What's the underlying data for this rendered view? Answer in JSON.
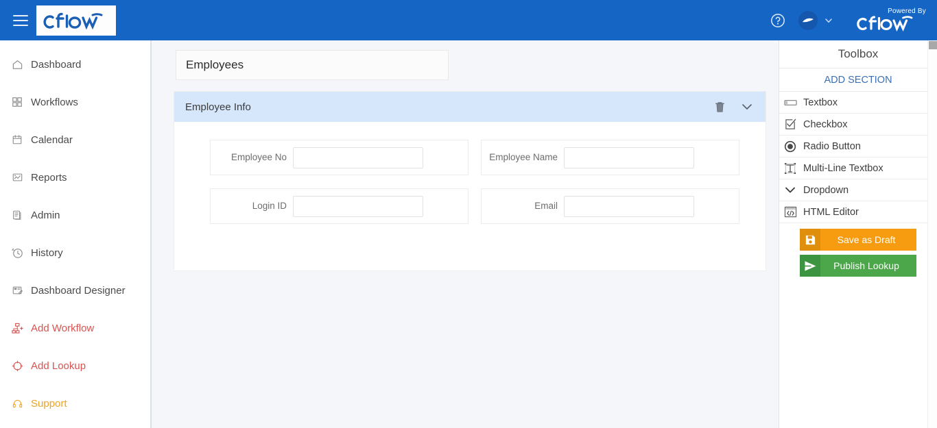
{
  "topbar": {
    "menu_icon": "hamburger-icon",
    "brand": "cflow",
    "help_icon": "help-circle-icon",
    "avatar_icon": "user-avatar-icon",
    "user_chevron_icon": "chevron-down-icon",
    "powered_by_label": "Powered By",
    "powered_brand": "cflow",
    "background_color": "#1565c4"
  },
  "sidebar": {
    "items": [
      {
        "label": "Dashboard",
        "icon": "home-icon",
        "accent": ""
      },
      {
        "label": "Workflows",
        "icon": "grid-icon",
        "accent": ""
      },
      {
        "label": "Calendar",
        "icon": "calendar-icon",
        "accent": ""
      },
      {
        "label": "Reports",
        "icon": "report-icon",
        "accent": ""
      },
      {
        "label": "Admin",
        "icon": "book-icon",
        "accent": ""
      },
      {
        "label": "History",
        "icon": "clock-icon",
        "accent": ""
      },
      {
        "label": "Dashboard Designer",
        "icon": "dashboard-designer-icon",
        "accent": ""
      },
      {
        "label": "Add Workflow",
        "icon": "add-workflow-icon",
        "accent": "red"
      },
      {
        "label": "Add Lookup",
        "icon": "add-lookup-icon",
        "accent": "red"
      },
      {
        "label": "Support",
        "icon": "headset-icon",
        "accent": "orange"
      }
    ],
    "accent_red": "#d9534f",
    "accent_orange": "#f0a121"
  },
  "main": {
    "form_title": "Employees",
    "section": {
      "title": "Employee Info",
      "header_color": "#d6e6fb",
      "delete_icon": "trash-icon",
      "collapse_icon": "chevron-down-icon",
      "fields": [
        {
          "label": "Employee No",
          "value": "",
          "placeholder": ""
        },
        {
          "label": "Employee Name",
          "value": "",
          "placeholder": ""
        },
        {
          "label": "Login ID",
          "value": "",
          "placeholder": ""
        },
        {
          "label": "Email",
          "value": "",
          "placeholder": ""
        }
      ]
    }
  },
  "toolbox": {
    "title": "Toolbox",
    "add_section_label": "ADD SECTION",
    "add_section_color": "#3a6fb5",
    "items": [
      {
        "label": "Textbox",
        "icon": "textbox-icon"
      },
      {
        "label": "Checkbox",
        "icon": "checkbox-icon"
      },
      {
        "label": "Radio Button",
        "icon": "radio-button-icon"
      },
      {
        "label": "Multi-Line Textbox",
        "icon": "multiline-textbox-icon"
      },
      {
        "label": "Dropdown",
        "icon": "chevron-down-icon"
      },
      {
        "label": "HTML Editor",
        "icon": "code-icon"
      }
    ],
    "actions": [
      {
        "label": "Save as Draft",
        "icon": "save-icon",
        "color": "#f79c10"
      },
      {
        "label": "Publish Lookup",
        "icon": "send-icon",
        "color": "#4ba749"
      }
    ]
  }
}
